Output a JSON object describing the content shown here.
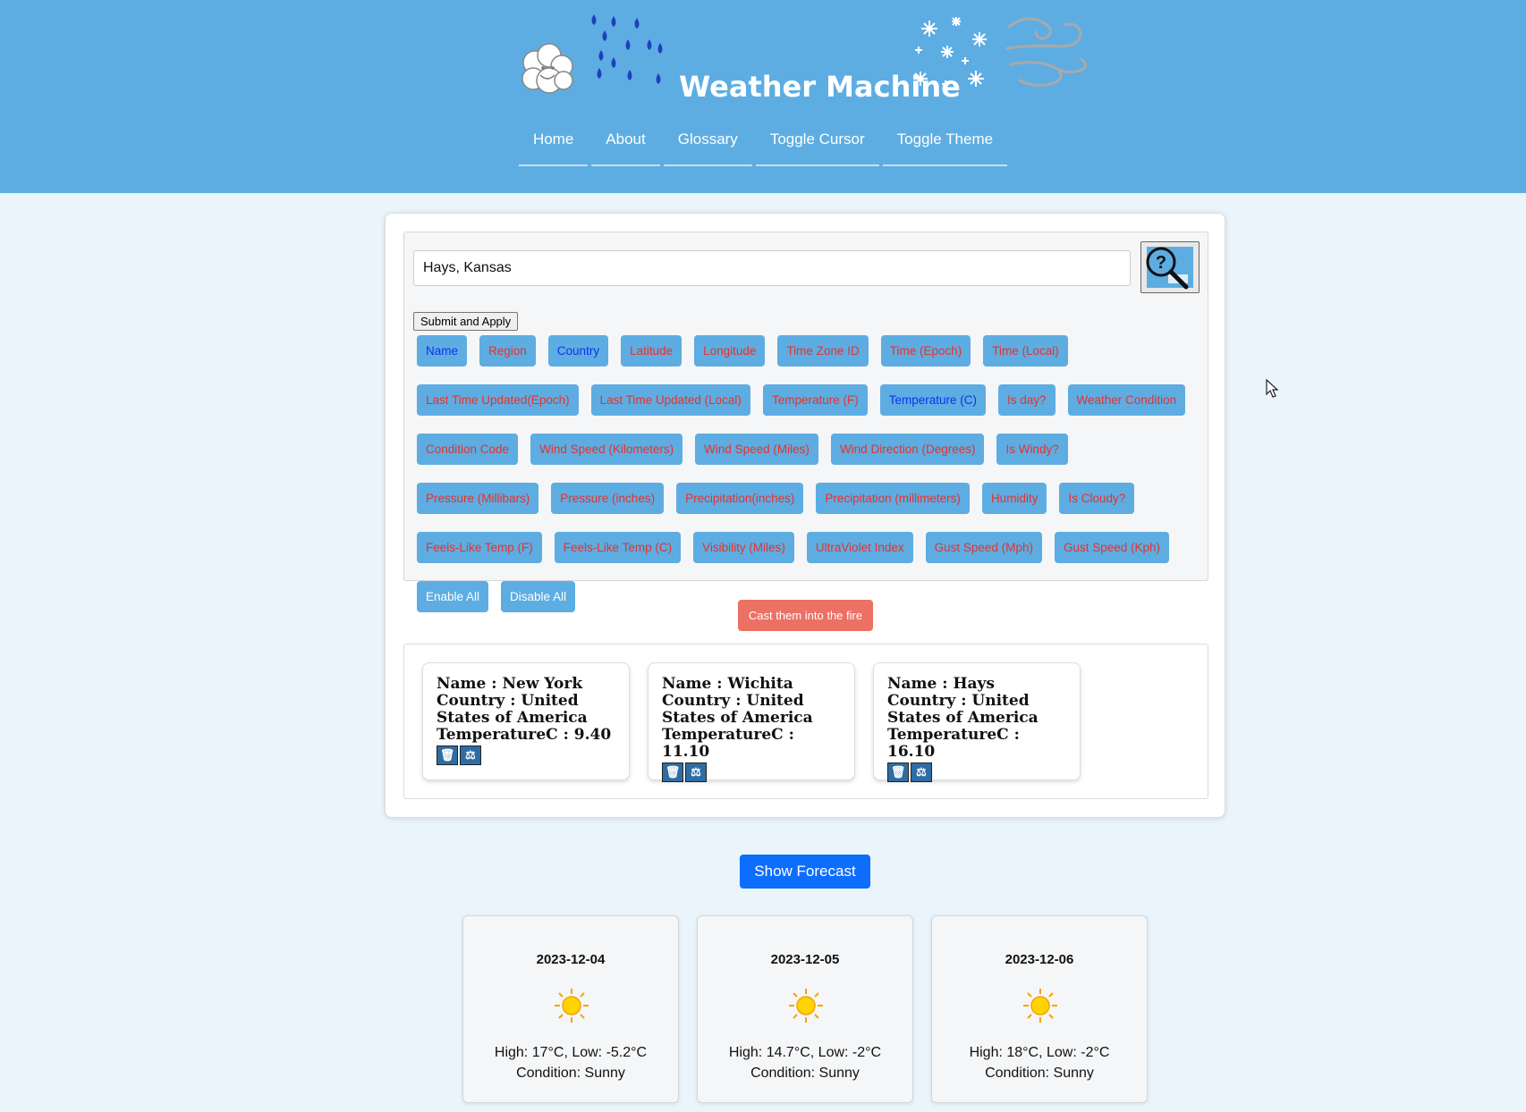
{
  "header": {
    "title": "Weather Machine",
    "nav": [
      "Home",
      "About",
      "Glossary",
      "Toggle Cursor",
      "Toggle Theme"
    ],
    "icons": [
      "cloud-icon",
      "raindrops-icon",
      "snowflakes-icon",
      "wind-icon"
    ]
  },
  "search": {
    "value": "Hays, Kansas",
    "button_icon": "search-magnifier-icon",
    "submit_label": "Submit and Apply"
  },
  "filters": [
    {
      "label": "Name",
      "state": "on"
    },
    {
      "label": "Region",
      "state": "off"
    },
    {
      "label": "Country",
      "state": "on"
    },
    {
      "label": "Latitude",
      "state": "off"
    },
    {
      "label": "Longitude",
      "state": "off"
    },
    {
      "label": "Time Zone ID",
      "state": "off"
    },
    {
      "label": "Time (Epoch)",
      "state": "off"
    },
    {
      "label": "Time (Local)",
      "state": "off"
    },
    {
      "label": "Last Time Updated(Epoch)",
      "state": "off"
    },
    {
      "label": "Last Time Updated (Local)",
      "state": "off"
    },
    {
      "label": "Temperature (F)",
      "state": "off"
    },
    {
      "label": "Temperature (C)",
      "state": "on"
    },
    {
      "label": "Is day?",
      "state": "off"
    },
    {
      "label": "Weather Condition",
      "state": "off"
    },
    {
      "label": "Condition Code",
      "state": "off"
    },
    {
      "label": "Wind Speed (Kilometers)",
      "state": "off"
    },
    {
      "label": "Wind Speed (Miles)",
      "state": "off"
    },
    {
      "label": "Wind Direction (Degrees)",
      "state": "off"
    },
    {
      "label": "Is Windy?",
      "state": "off"
    },
    {
      "label": "Pressure (Millibars)",
      "state": "off"
    },
    {
      "label": "Pressure (inches)",
      "state": "off"
    },
    {
      "label": "Precipitation(inches)",
      "state": "off"
    },
    {
      "label": "Precipitation (millimeters)",
      "state": "off"
    },
    {
      "label": "Humidity",
      "state": "off"
    },
    {
      "label": "Is Cloudy?",
      "state": "off"
    },
    {
      "label": "Feels-Like Temp (F)",
      "state": "off"
    },
    {
      "label": "Feels-Like Temp (C)",
      "state": "off"
    },
    {
      "label": "Visibility (Miles)",
      "state": "off"
    },
    {
      "label": "UltraViolet Index",
      "state": "off"
    },
    {
      "label": "Gust Speed (Mph)",
      "state": "off"
    },
    {
      "label": "Gust Speed (Kph)",
      "state": "off"
    }
  ],
  "actions": {
    "enable_all": "Enable All",
    "disable_all": "Disable All",
    "cast_fire": "Cast them into the fire",
    "show_forecast": "Show Forecast"
  },
  "locations": [
    {
      "name": "Name : New York",
      "country": "Country : United States of America",
      "temp": "TemperatureC : 9.40"
    },
    {
      "name": "Name : Wichita",
      "country": "Country : United States of America",
      "temp": "TemperatureC : 11.10"
    },
    {
      "name": "Name : Hays",
      "country": "Country : United States of America",
      "temp": "TemperatureC : 16.10"
    }
  ],
  "location_icons": [
    "trash-icon",
    "compare-scale-icon"
  ],
  "forecast": [
    {
      "date": "2023-12-04",
      "icon": "sun-icon",
      "high_low": "High: 17°C, Low: -5.2°C",
      "condition": "Condition: Sunny"
    },
    {
      "date": "2023-12-05",
      "icon": "sun-icon",
      "high_low": "High: 14.7°C, Low: -2°C",
      "condition": "Condition: Sunny"
    },
    {
      "date": "2023-12-06",
      "icon": "sun-icon",
      "high_low": "High: 18°C, Low: -2°C",
      "condition": "Condition: Sunny"
    }
  ],
  "colors": {
    "header_bg": "#5dade2",
    "page_bg": "#eaf4fb",
    "chip_bg": "#5dade2",
    "chip_off_text": "#e8312c",
    "chip_on_text": "#1030ee",
    "fire_button": "#ec7063",
    "forecast_button": "#0d6efd"
  }
}
